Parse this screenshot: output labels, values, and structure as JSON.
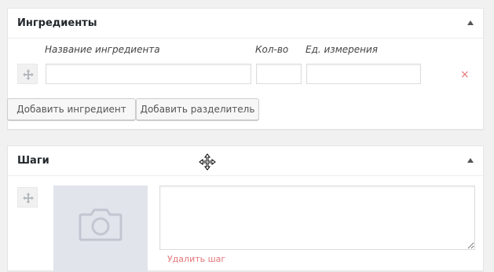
{
  "ingredients": {
    "title": "Ингредиенты",
    "columns": {
      "name": "Название ингредиента",
      "qty": "Кол-во",
      "unit": "Ед. измерения"
    },
    "rows": [
      {
        "name": "",
        "qty": "",
        "unit": "",
        "remove_label": "×"
      }
    ],
    "buttons": {
      "add_ingredient": "Добавить ингредиент",
      "add_separator": "Добавить разделитель"
    }
  },
  "steps": {
    "title": "Шаги",
    "step_text": "",
    "remove_link": "Удалить шаг"
  },
  "icons": {
    "panel_toggle": "triangle-up-icon",
    "drag": "move-handle-icon",
    "remove": "close-icon",
    "photo": "camera-icon",
    "cursor": "move-cursor-icon"
  },
  "colors": {
    "remove": "#e4777a",
    "panel_bg": "#ffffff",
    "page_bg": "#f1f1f1",
    "photo_placeholder": "#e2e4ec"
  }
}
